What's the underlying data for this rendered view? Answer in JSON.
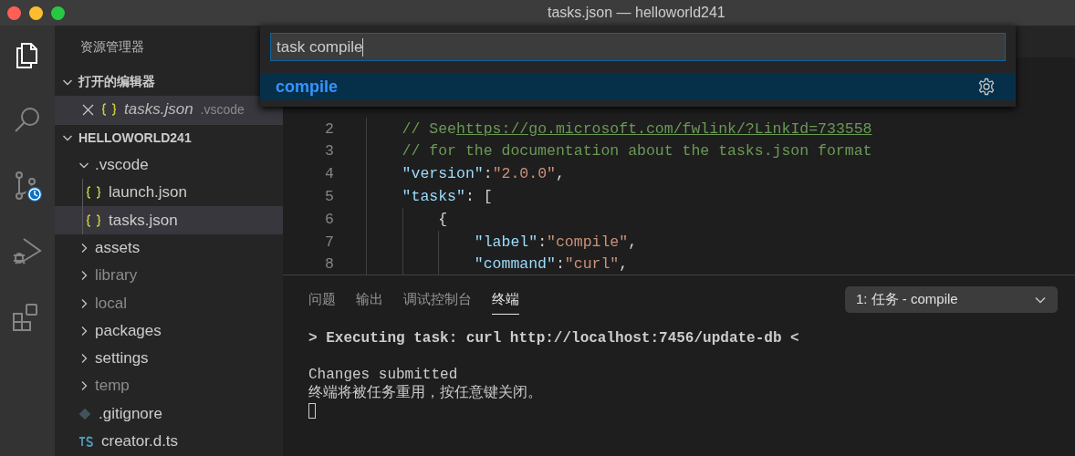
{
  "window": {
    "title": "tasks.json — helloworld241"
  },
  "activity_bar": [
    {
      "kind": "explorer",
      "selected": true
    },
    {
      "kind": "search",
      "selected": false
    },
    {
      "kind": "source-control",
      "selected": false
    },
    {
      "kind": "debug",
      "selected": false
    },
    {
      "kind": "extensions",
      "selected": false
    }
  ],
  "sidebar": {
    "title": "资源管理器",
    "open_editors": {
      "title": "打开的编辑器",
      "expanded": true,
      "items": [
        {
          "name": "tasks.json",
          "folder": ".vscode",
          "kind": "json",
          "preview": true,
          "selected": true
        }
      ]
    },
    "project": {
      "title": "HELLOWORLD241",
      "expanded": true,
      "items": [
        {
          "name": ".vscode",
          "kind": "folder",
          "expanded": true,
          "dimmed": false,
          "selected": false,
          "children": [
            {
              "name": "launch.json",
              "kind": "json",
              "dimmed": false,
              "selected": false
            },
            {
              "name": "tasks.json",
              "kind": "json",
              "dimmed": false,
              "selected": true
            }
          ]
        },
        {
          "name": "assets",
          "kind": "folder",
          "expanded": false,
          "dimmed": false,
          "selected": false
        },
        {
          "name": "library",
          "kind": "folder",
          "expanded": false,
          "dimmed": true,
          "selected": false
        },
        {
          "name": "local",
          "kind": "folder",
          "expanded": false,
          "dimmed": true,
          "selected": false
        },
        {
          "name": "packages",
          "kind": "folder",
          "expanded": false,
          "dimmed": false,
          "selected": false
        },
        {
          "name": "settings",
          "kind": "folder",
          "expanded": false,
          "dimmed": false,
          "selected": false
        },
        {
          "name": "temp",
          "kind": "folder",
          "expanded": false,
          "dimmed": true,
          "selected": false
        },
        {
          "name": ".gitignore",
          "kind": "git",
          "dimmed": false,
          "selected": false
        },
        {
          "name": "creator.d.ts",
          "kind": "ts",
          "dimmed": false,
          "selected": false
        }
      ]
    }
  },
  "quick_open": {
    "value": "task compile",
    "results": [
      {
        "label": "compile",
        "selected": true
      }
    ]
  },
  "editor": {
    "lines": [
      {
        "number": "2",
        "tokens": [
          {
            "kind": "comment",
            "text": "// See"
          },
          {
            "kind": "link",
            "text": "https://go.microsoft.com/fwlink/?LinkId=733558"
          }
        ]
      },
      {
        "number": "3",
        "tokens": [
          {
            "kind": "comment",
            "text": "// for the documentation about the tasks.json format"
          }
        ]
      },
      {
        "number": "4",
        "tokens": [
          {
            "kind": "key",
            "text": "\"version\""
          },
          {
            "kind": "punct",
            "text": ":"
          },
          {
            "kind": "string",
            "text": "\"2.0.0\""
          },
          {
            "kind": "punct",
            "text": ","
          }
        ]
      },
      {
        "number": "5",
        "tokens": [
          {
            "kind": "key",
            "text": "\"tasks\""
          },
          {
            "kind": "punct",
            "text": ": ["
          }
        ],
        "children": [
          {
            "number": "6",
            "tokens": [
              {
                "kind": "punct",
                "text": "{"
              }
            ],
            "children": [
              {
                "number": "7",
                "tokens": [
                  {
                    "kind": "key",
                    "text": "\"label\""
                  },
                  {
                    "kind": "punct",
                    "text": ":"
                  },
                  {
                    "kind": "string",
                    "text": "\"compile\""
                  },
                  {
                    "kind": "punct",
                    "text": ","
                  }
                ]
              },
              {
                "number": "8",
                "tokens": [
                  {
                    "kind": "key",
                    "text": "\"command\""
                  },
                  {
                    "kind": "punct",
                    "text": ":"
                  },
                  {
                    "kind": "string",
                    "text": "\"curl\""
                  },
                  {
                    "kind": "punct",
                    "text": ","
                  }
                ]
              }
            ]
          }
        ]
      }
    ]
  },
  "panel": {
    "tabs": [
      {
        "label": "问题",
        "selected": false
      },
      {
        "label": "输出",
        "selected": false
      },
      {
        "label": "调试控制台",
        "selected": false
      },
      {
        "label": "终端",
        "selected": true
      }
    ],
    "terminal_select": "1: 任务 - compile",
    "terminal": [
      {
        "kind": "command",
        "text": "> Executing task: curl http://localhost:7456/update-db <"
      },
      {
        "kind": "blank"
      },
      {
        "kind": "output",
        "text": "Changes submitted"
      },
      {
        "kind": "output",
        "text": "终端将被任务重用，按任意键关闭。"
      },
      {
        "kind": "cursor"
      }
    ]
  }
}
